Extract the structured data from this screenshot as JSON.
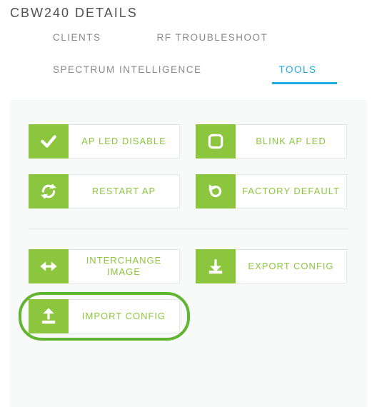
{
  "page_title": "CBW240 DETAILS",
  "tabs": {
    "clients": "CLIENTS",
    "rf": "RF TROUBLESHOOT",
    "spectrum": "SPECTRUM INTELLIGENCE",
    "tools": "TOOLS"
  },
  "active_tab": "tools",
  "buttons": {
    "ap_led_disable": "AP LED DISABLE",
    "blink_ap_led": "BLINK AP LED",
    "restart_ap": "RESTART AP",
    "factory_default": "FACTORY DEFAULT",
    "interchange_image": "INTERCHANGE IMAGE",
    "export_config": "EXPORT CONFIG",
    "import_config": "IMPORT CONFIG"
  },
  "colors": {
    "accent_green": "#8cc63f",
    "accent_blue": "#1fa9e2",
    "panel_bg": "#f8f9f9"
  }
}
